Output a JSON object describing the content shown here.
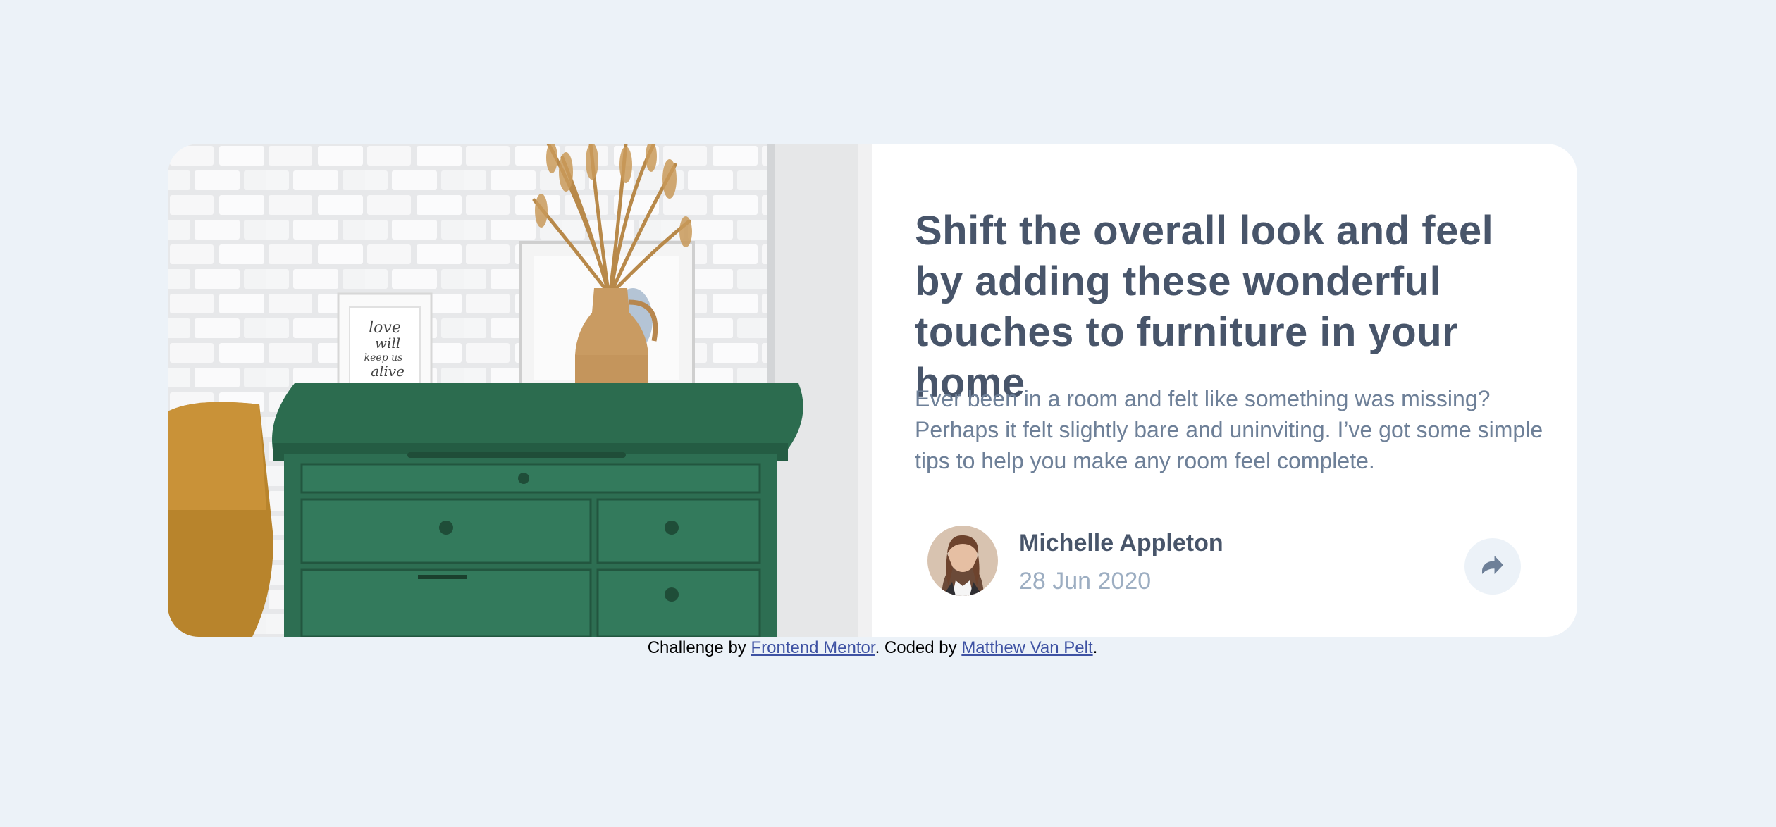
{
  "article": {
    "headline": "Shift the overall look and feel by adding these wonderful touches to furniture in your home",
    "excerpt": "Ever been in a room and felt like something was missing? Perhaps it felt slightly bare and uninviting. I’ve got some simple tips to help you make any room feel complete."
  },
  "author": {
    "name": "Michelle Appleton",
    "date": "28 Jun 2020"
  },
  "share": {
    "icon": "share-icon"
  },
  "attribution": {
    "prefix": "Challenge by ",
    "link1_text": "Frontend Mentor",
    "middle": ". Coded by ",
    "link2_text": "Matthew Van Pelt",
    "suffix": "."
  },
  "photo": {
    "frame_text": [
      "love",
      "will",
      "keep us",
      "alive"
    ]
  },
  "colors": {
    "background": "#ecf2f8",
    "card": "#ffffff",
    "headline": "#48556a",
    "body": "#6e8098",
    "muted": "#9daec2",
    "link": "#3d53a1"
  }
}
